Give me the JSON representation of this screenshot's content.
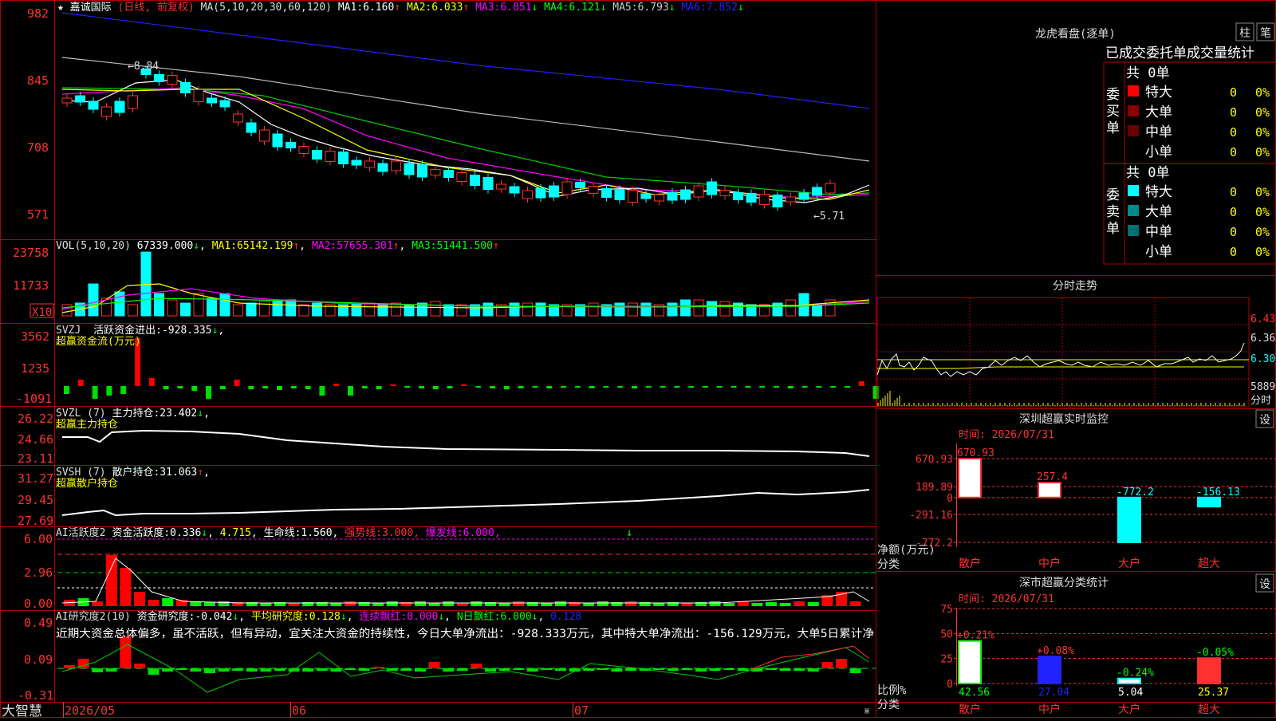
{
  "stock": {
    "star": "★",
    "name": "嘉诚国际",
    "mode": "(日线, 前复权)"
  },
  "panels": {
    "main": {
      "indicator_label": "MA(5,10,20,30,60,120)",
      "ma": [
        {
          "label": "MA1:",
          "value": "6.160",
          "arrow": "↑",
          "color": "#ffffff"
        },
        {
          "label": "MA2:",
          "value": "6.033",
          "arrow": "↑",
          "color": "#ffff00"
        },
        {
          "label": "MA3:",
          "value": "6.051",
          "arrow": "↓",
          "color": "#ff00ff"
        },
        {
          "label": "MA4:",
          "value": "6.121",
          "arrow": "↓",
          "color": "#00ff00"
        },
        {
          "label": "MA5:",
          "value": "6.793",
          "arrow": "↓",
          "color": "#cccccc"
        },
        {
          "label": "MA6:",
          "value": "7.852",
          "arrow": "↓",
          "color": "#2222ff"
        }
      ],
      "y_ticks": [
        "982",
        "845",
        "708",
        "571"
      ],
      "high_label": "←8.84",
      "low_label": "←5.71"
    },
    "vol": {
      "label": "VOL(5,10,20)",
      "value": "67339.000",
      "value_arrow": "↓",
      "ma": [
        {
          "label": "MA1:",
          "value": "65142.199",
          "arrow": "↑",
          "color": "#ffff00"
        },
        {
          "label": "MA2:",
          "value": "57655.301",
          "arrow": "↑",
          "color": "#ff00ff"
        },
        {
          "label": "MA3:",
          "value": "51441.500",
          "arrow": "↑",
          "color": "#00ff00"
        }
      ],
      "y_ticks": [
        "23758",
        "11733"
      ],
      "unit": "X10"
    },
    "svzj": {
      "label": "SVZJ",
      "desc": "活跃资金进出:",
      "value": "-928.335",
      "arrow": "↓",
      "comma": ",",
      "subtitle": "超赢资金流(万元)",
      "y_ticks": [
        "3562",
        "1235",
        "-1091"
      ]
    },
    "svzl": {
      "label": "SVZL (7)",
      "desc": "主力持仓:",
      "value": "23.402",
      "arrow": "↓",
      "comma": ",",
      "subtitle": "超赢主力持仓",
      "y_ticks": [
        "26.22",
        "24.66",
        "23.11"
      ]
    },
    "svsh": {
      "label": "SVSH (7)",
      "desc": "散户持仓:",
      "value": "31.063",
      "arrow": "↑",
      "comma": ",",
      "subtitle": "超赢散户持仓",
      "y_ticks": [
        "31.27",
        "29.45",
        "27.69"
      ]
    },
    "ai1": {
      "label": "AI活跃度2",
      "a_label": "资金活跃度:",
      "a_value": "0.336",
      "a_arrow": "↓",
      "b_value": "4.715",
      "b_suffix": ",",
      "c_label": "生命线:",
      "c_value": "1.560,",
      "d_label": "强势线:",
      "d_value": "3.000,",
      "e_label": "爆发线:",
      "e_value": "6.000,",
      "y_ticks": [
        "6.00",
        "2.96",
        "0.00"
      ]
    },
    "ai2": {
      "label": "AI研究度2(10)",
      "a_label": "资金研究度:",
      "a_value": "-0.042",
      "a_arrow": "↓",
      "b_label": "平均研究度:",
      "b_value": "0.128",
      "b_arrow": "↓",
      "c_label": "连续飘红:",
      "c_value": "0.000",
      "c_arrow": "↓",
      "d_label": "N日飘红:",
      "d_value": "6.000",
      "d_arrow": "↓",
      "e_value": "0.128",
      "comment": "近期大资金总体偏多，虽不活跃，但有异动，宜关注大资金的持续性，今日大单净流出：-928.333万元，其中特大单净流出：-156.129万元，大单5日累计净",
      "y_ticks": [
        "0.49",
        "0.09",
        "-0.31"
      ]
    }
  },
  "x_axis": {
    "labels": [
      "2026/05",
      "06",
      "07"
    ]
  },
  "bottom_left": "大智慧",
  "right": {
    "lhb": {
      "title": "龙虎看盘(逐单)",
      "btn1": "柱",
      "btn2": "笔",
      "header": "已成交委托单成交量统计",
      "buy": {
        "side_label": "委买单",
        "total": "共 0单",
        "rows": [
          {
            "name": "特大",
            "count": "0",
            "pct": "0%",
            "color": "#ff0000"
          },
          {
            "name": "大单",
            "count": "0",
            "pct": "0%",
            "color": "#8b0000"
          },
          {
            "name": "中单",
            "count": "0",
            "pct": "0%",
            "color": "#6b0000"
          },
          {
            "name": "小单",
            "count": "0",
            "pct": "0%",
            "color": ""
          }
        ]
      },
      "sell": {
        "side_label": "委卖单",
        "total": "共 0单",
        "rows": [
          {
            "name": "特大",
            "count": "0",
            "pct": "0%",
            "color": "#00ffff"
          },
          {
            "name": "大单",
            "count": "0",
            "pct": "0%",
            "color": "#008b8b"
          },
          {
            "name": "中单",
            "count": "0",
            "pct": "0%",
            "color": "#007070"
          },
          {
            "name": "小单",
            "count": "0",
            "pct": "0%",
            "color": ""
          }
        ]
      }
    },
    "intraday": {
      "title": "分时走势",
      "prices": [
        "6.43",
        "6.36",
        "6.30"
      ],
      "volume": "5889",
      "volume_unit": "分时"
    },
    "monitor": {
      "title": "深圳超赢实时监控",
      "set": "设",
      "time": "时间: 2026/07/31",
      "y_ticks": [
        "670.93",
        "189.89",
        "0",
        "-291.16",
        "-772.2"
      ],
      "y_unit": "净额(万元)",
      "x_title": "分类"
    },
    "stats": {
      "title": "深市超赢分类统计",
      "set": "设",
      "time": "时间: 2026/07/31",
      "y_ticks": [
        "75",
        "50",
        "25",
        "0"
      ],
      "y_unit": "比例%",
      "x_title": "分类"
    }
  },
  "chart_data": [
    {
      "type": "candlestick",
      "title": "嘉诚国际 (日线, 前复权)",
      "ylim": [
        5.71,
        9.82
      ],
      "high": 8.84,
      "low": 5.71,
      "last_ma": {
        "MA5": 6.16,
        "MA10": 6.033,
        "MA20": 6.051,
        "MA30": 6.121,
        "MA60": 6.793,
        "MA120": 7.852
      }
    },
    {
      "type": "bar",
      "title": "深圳超赢实时监控",
      "categories": [
        "散户",
        "中户",
        "大户",
        "超大"
      ],
      "values": [
        670.93,
        257.4,
        -772.2,
        -156.13
      ],
      "ylabel": "净额(万元)",
      "ylim": [
        -772.2,
        670.93
      ]
    },
    {
      "type": "bar",
      "title": "深市超赢分类统计",
      "categories": [
        "散户",
        "中户",
        "大户",
        "超大"
      ],
      "values": [
        42.56,
        27.04,
        5.04,
        25.37
      ],
      "changes": [
        "+0.21%",
        "+0.08%",
        "-0.24%",
        "-0.05%"
      ],
      "ylabel": "比例%",
      "ylim": [
        0,
        75
      ]
    }
  ]
}
